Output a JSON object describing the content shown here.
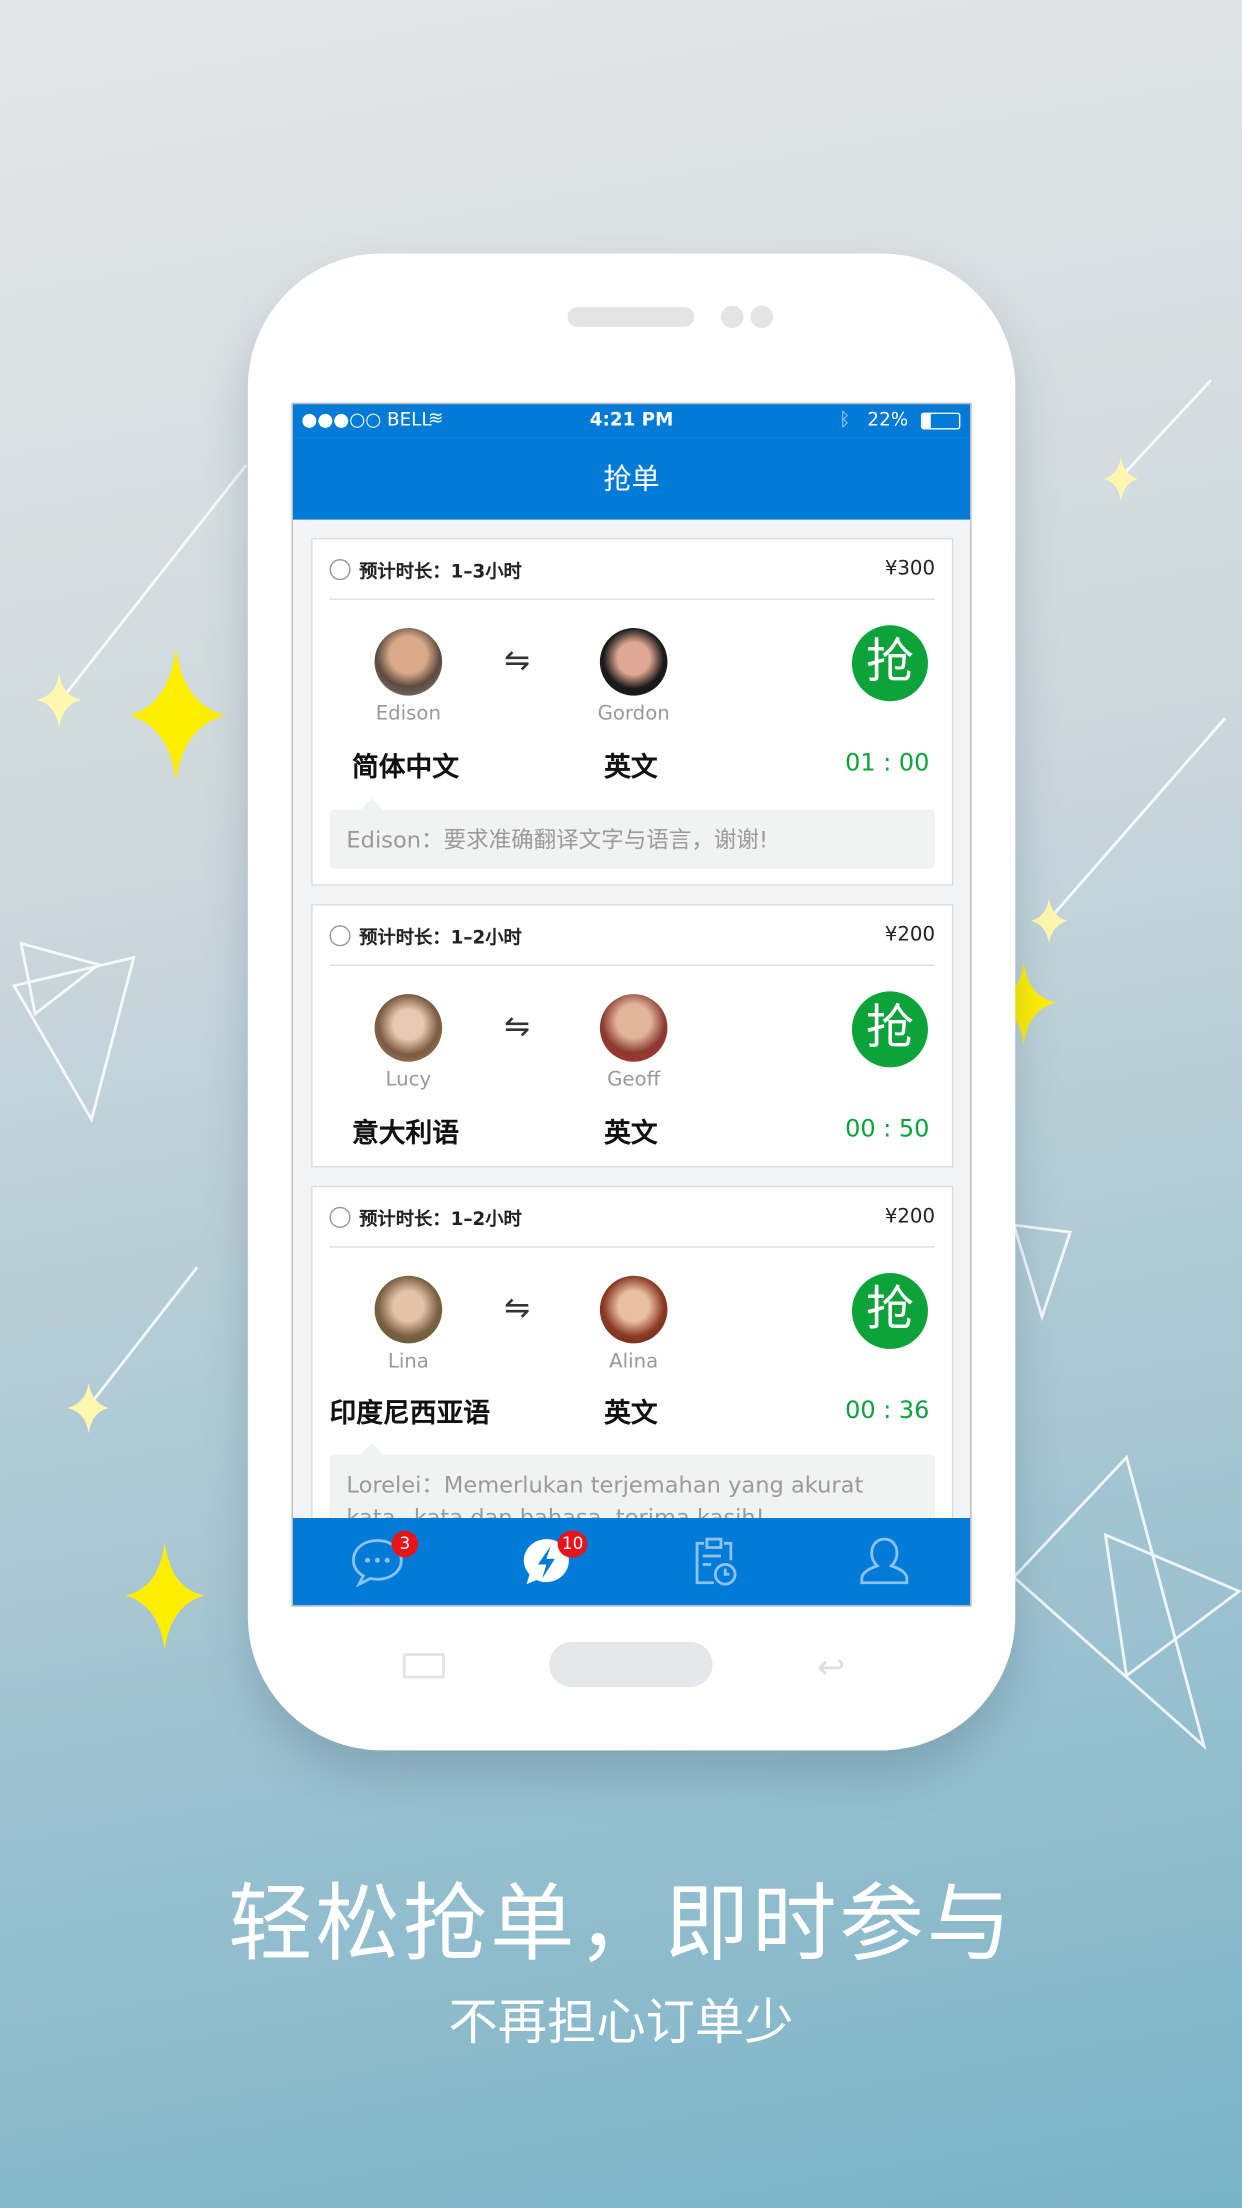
{
  "status_bar": {
    "carrier": "●●●○○ BELL",
    "time": "4:21 PM",
    "battery": "22%",
    "battery_level": 0.22
  },
  "nav": {
    "title": "抢单"
  },
  "orders": [
    {
      "duration": "预计时长：1–3小时",
      "price": "¥300",
      "from_user": "Edison",
      "to_user": "Gordon",
      "from_lang": "简体中文",
      "to_lang": "英文",
      "timer": "01 : 00",
      "grab_label": "抢",
      "message": "Edison：要求准确翻译文字与语言，谢谢!"
    },
    {
      "duration": "预计时长：1–2小时",
      "price": "¥200",
      "from_user": "Lucy",
      "to_user": "Geoff",
      "from_lang": "意大利语",
      "to_lang": "英文",
      "timer": "00 : 50",
      "grab_label": "抢"
    },
    {
      "duration": "预计时长：1–2小时",
      "price": "¥200",
      "from_user": "Lina",
      "to_user": "Alina",
      "from_lang": "印度尼西亚语",
      "to_lang": "英文",
      "timer": "00 : 36",
      "grab_label": "抢",
      "message": "Lorelei：Memerlukan terjemahan yang akurat kata –kata dan bahasa, terima kasih!"
    }
  ],
  "tabbar": {
    "messages_badge": "3",
    "grab_badge": "10",
    "icons": [
      "chat-icon",
      "lightning-icon",
      "clipboard-clock-icon",
      "user-icon"
    ]
  },
  "promo": {
    "headline": "轻松抢单，即时参与",
    "subline": "不再担心订单少"
  },
  "colors": {
    "primary": "#027bd8",
    "grab": "#0ea33a",
    "badge": "#e8141c"
  }
}
